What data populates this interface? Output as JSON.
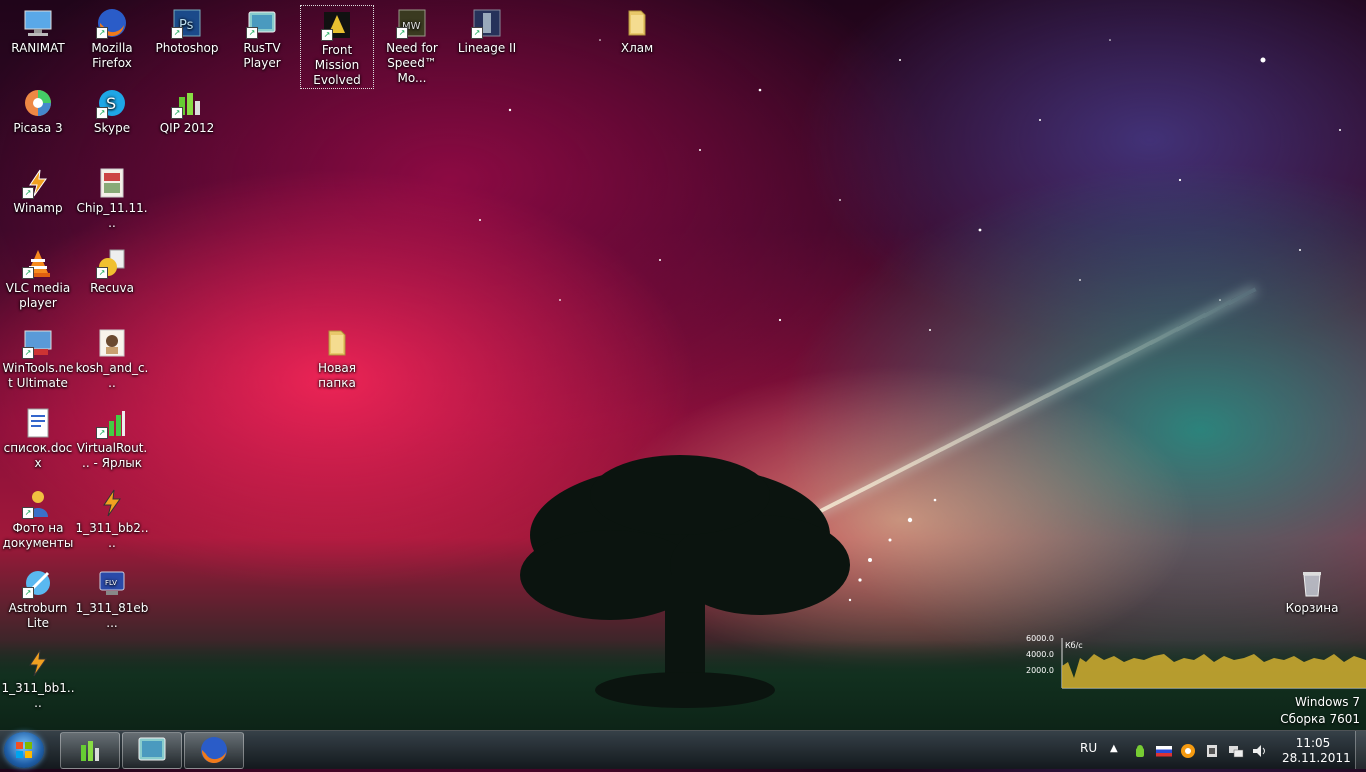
{
  "desktop": {
    "icons": [
      {
        "label": "RANIMAT"
      },
      {
        "label": "Mozilla Firefox"
      },
      {
        "label": "Photoshop"
      },
      {
        "label": "RusTV Player"
      },
      {
        "label": "Front Mission Evolved"
      },
      {
        "label": "Need for Speed™ Mo..."
      },
      {
        "label": "Lineage II"
      },
      {
        "label": "Хлам"
      },
      {
        "label": "Picasa 3"
      },
      {
        "label": "Skype"
      },
      {
        "label": "QIP 2012"
      },
      {
        "label": "Winamp"
      },
      {
        "label": "Chip_11.11..."
      },
      {
        "label": "VLC media player"
      },
      {
        "label": "Recuva"
      },
      {
        "label": "WinTools.net Ultimate"
      },
      {
        "label": "kosh_and_c..."
      },
      {
        "label": "Новая папка"
      },
      {
        "label": "список.docx"
      },
      {
        "label": "VirtualRout... - Ярлык"
      },
      {
        "label": "Фото на документы"
      },
      {
        "label": "1_311_bb2...."
      },
      {
        "label": "Astroburn Lite"
      },
      {
        "label": "1_311_81eb..."
      },
      {
        "label": "1_311_bb1...."
      },
      {
        "label": "Корзина"
      }
    ]
  },
  "gadget": {
    "max_label": "6000.0",
    "unit": "Кб/с",
    "mid_label": "4000.0",
    "low_label": "2000.0"
  },
  "watermark": {
    "line1": "Windows 7",
    "line2": "Сборка 7601"
  },
  "taskbar": {
    "language": "RU",
    "time": "11:05",
    "date": "28.11.2011"
  },
  "colors": {
    "taskbar": "#1e262c",
    "start_orb": "#1f5fa8",
    "graph_fill": "#c9a830"
  }
}
